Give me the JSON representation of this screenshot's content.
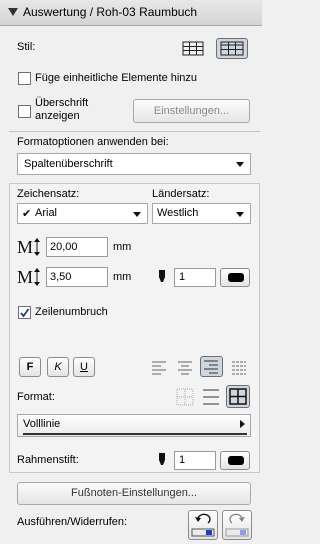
{
  "window": {
    "title": "Auswertung / Roh-03 Raumbuch"
  },
  "style_section": {
    "label": "Stil:",
    "cb_uniform_label": "Füge einheitliche Elemente hinzu",
    "cb_header_label_line1": "Überschrift",
    "cb_header_label_line2": "anzeigen",
    "settings_button": "Einstellungen..."
  },
  "format_apply": {
    "label": "Formatoptionen anwenden bei:",
    "selected": "Spaltenüberschrift"
  },
  "font": {
    "charset_label": "Zeichensatz:",
    "charset_value": "Arial",
    "charset_check": "✔",
    "country_label": "Ländersatz:",
    "country_value": "Westlich",
    "size_value": "20,00",
    "size_unit": "mm",
    "spacing_value": "3,50",
    "spacing_unit": "mm",
    "pen_value": "1",
    "wrap_label": "Zeilenumbruch",
    "bold_label": "F",
    "italic_label": "K",
    "underline_label": "U"
  },
  "border": {
    "format_label": "Format:",
    "line_type": "Volllinie",
    "pen_label": "Rahmenstift:",
    "pen_value": "1"
  },
  "footer": {
    "footnote_button": "Fußnoten-Einstellungen...",
    "undo_label": "Ausführen/Widerrufen:"
  }
}
